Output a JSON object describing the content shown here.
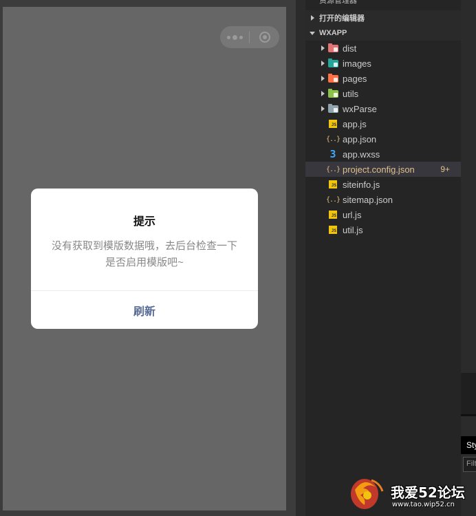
{
  "modal": {
    "title": "提示",
    "content": "没有获取到模版数据哦，去后台检查一下是否启用模版吧~",
    "button_label": "刷新"
  },
  "explorer": {
    "header_partial": "资源管理器",
    "sections": {
      "open_editors": "打开的编辑器",
      "project": "WXAPP"
    },
    "folders": [
      {
        "label": "dist",
        "icon": "folder-dist-icon",
        "color": "#e57373"
      },
      {
        "label": "images",
        "icon": "folder-images-icon",
        "color": "#26a69a"
      },
      {
        "label": "pages",
        "icon": "folder-pages-icon",
        "color": "#ff7043"
      },
      {
        "label": "utils",
        "icon": "folder-utils-icon",
        "color": "#8bc34a"
      },
      {
        "label": "wxParse",
        "icon": "folder-icon",
        "color": "#90a4ae"
      }
    ],
    "files": [
      {
        "label": "app.js",
        "icon": "js-file-icon"
      },
      {
        "label": "app.json",
        "icon": "json-file-icon"
      },
      {
        "label": "app.wxss",
        "icon": "css-file-icon"
      },
      {
        "label": "project.config.json",
        "icon": "json-file-icon",
        "badge": "9+"
      },
      {
        "label": "siteinfo.js",
        "icon": "js-file-icon"
      },
      {
        "label": "sitemap.json",
        "icon": "json-file-icon"
      },
      {
        "label": "url.js",
        "icon": "js-file-icon"
      },
      {
        "label": "util.js",
        "icon": "js-file-icon"
      }
    ]
  },
  "right_panel": {
    "tab_partial": "Sty",
    "filter_partial": "Filt"
  },
  "watermark": {
    "text": "我爱52论坛",
    "url": "www.tao.wip52.cn"
  },
  "colors": {
    "simulator_bg": "#666666",
    "modal_button": "#576b95",
    "explorer_bg": "#252526",
    "modified_file": "#e2c08d"
  }
}
